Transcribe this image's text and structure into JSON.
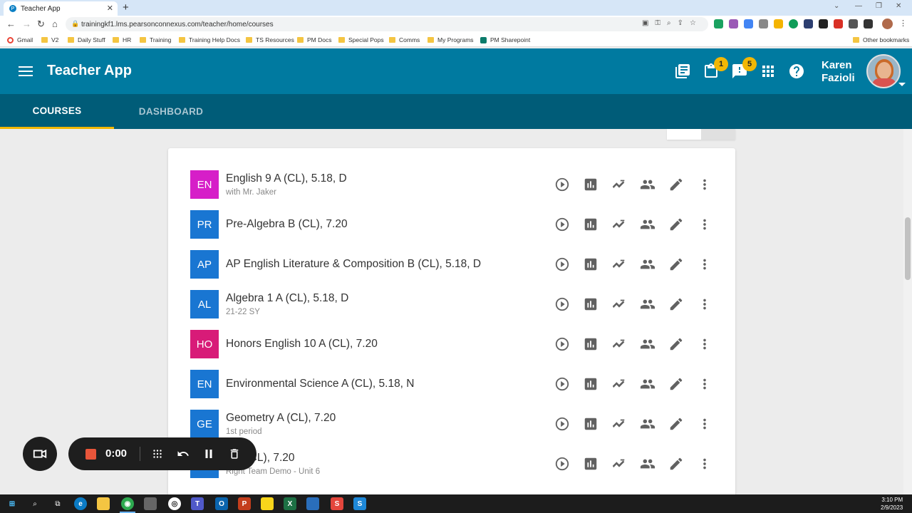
{
  "browser": {
    "tab_title": "Teacher App",
    "url": "trainingkf1.lms.pearsonconnexus.com/teacher/home/courses",
    "bookmarks": [
      "Gmail",
      "V2",
      "Daily Stuff",
      "HR",
      "Training",
      "Training Help Docs",
      "TS Resources",
      "PM Docs",
      "Special Pops",
      "Comms",
      "My Programs",
      "PM Sharepoint"
    ],
    "other_bookmarks": "Other bookmarks"
  },
  "header": {
    "title": "Teacher App",
    "assignments_badge": "1",
    "alerts_badge": "5",
    "user_first": "Karen",
    "user_last": "Fazioli"
  },
  "tabs": [
    {
      "label": "COURSES",
      "active": true
    },
    {
      "label": "DASHBOARD",
      "active": false
    }
  ],
  "courses": [
    {
      "abbr": "EN",
      "title": "English 9 A (CL), 5.18, D",
      "subtitle": "with Mr. Jaker",
      "color": "#d61ec8"
    },
    {
      "abbr": "PR",
      "title": "Pre-Algebra B (CL), 7.20",
      "subtitle": "",
      "color": "#1976d2"
    },
    {
      "abbr": "AP",
      "title": "AP English Literature & Composition B (CL), 5.18, D",
      "subtitle": "",
      "color": "#1976d2"
    },
    {
      "abbr": "AL",
      "title": "Algebra 1 A (CL), 5.18, D",
      "subtitle": "21-22 SY",
      "color": "#1976d2"
    },
    {
      "abbr": "HO",
      "title": "Honors English 10 A (CL), 7.20",
      "subtitle": "",
      "color": "#d81b78"
    },
    {
      "abbr": "EN",
      "title": "Environmental Science A (CL), 5.18, N",
      "subtitle": "",
      "color": "#1976d2"
    },
    {
      "abbr": "GE",
      "title": "Geometry A (CL), 7.20",
      "subtitle": "1st period",
      "color": "#1976d2"
    },
    {
      "abbr": "",
      "title": "K A (CL), 7.20",
      "subtitle": "Right Team Demo - Unit 6",
      "color": "#1976d2"
    }
  ],
  "recorder": {
    "time": "0:00"
  },
  "taskbar": {
    "time": "3:10 PM",
    "date": "2/9/2023"
  },
  "colors": {
    "header_bg": "#007aa0",
    "tabs_bg": "#005c78",
    "accent": "#f2b705"
  }
}
